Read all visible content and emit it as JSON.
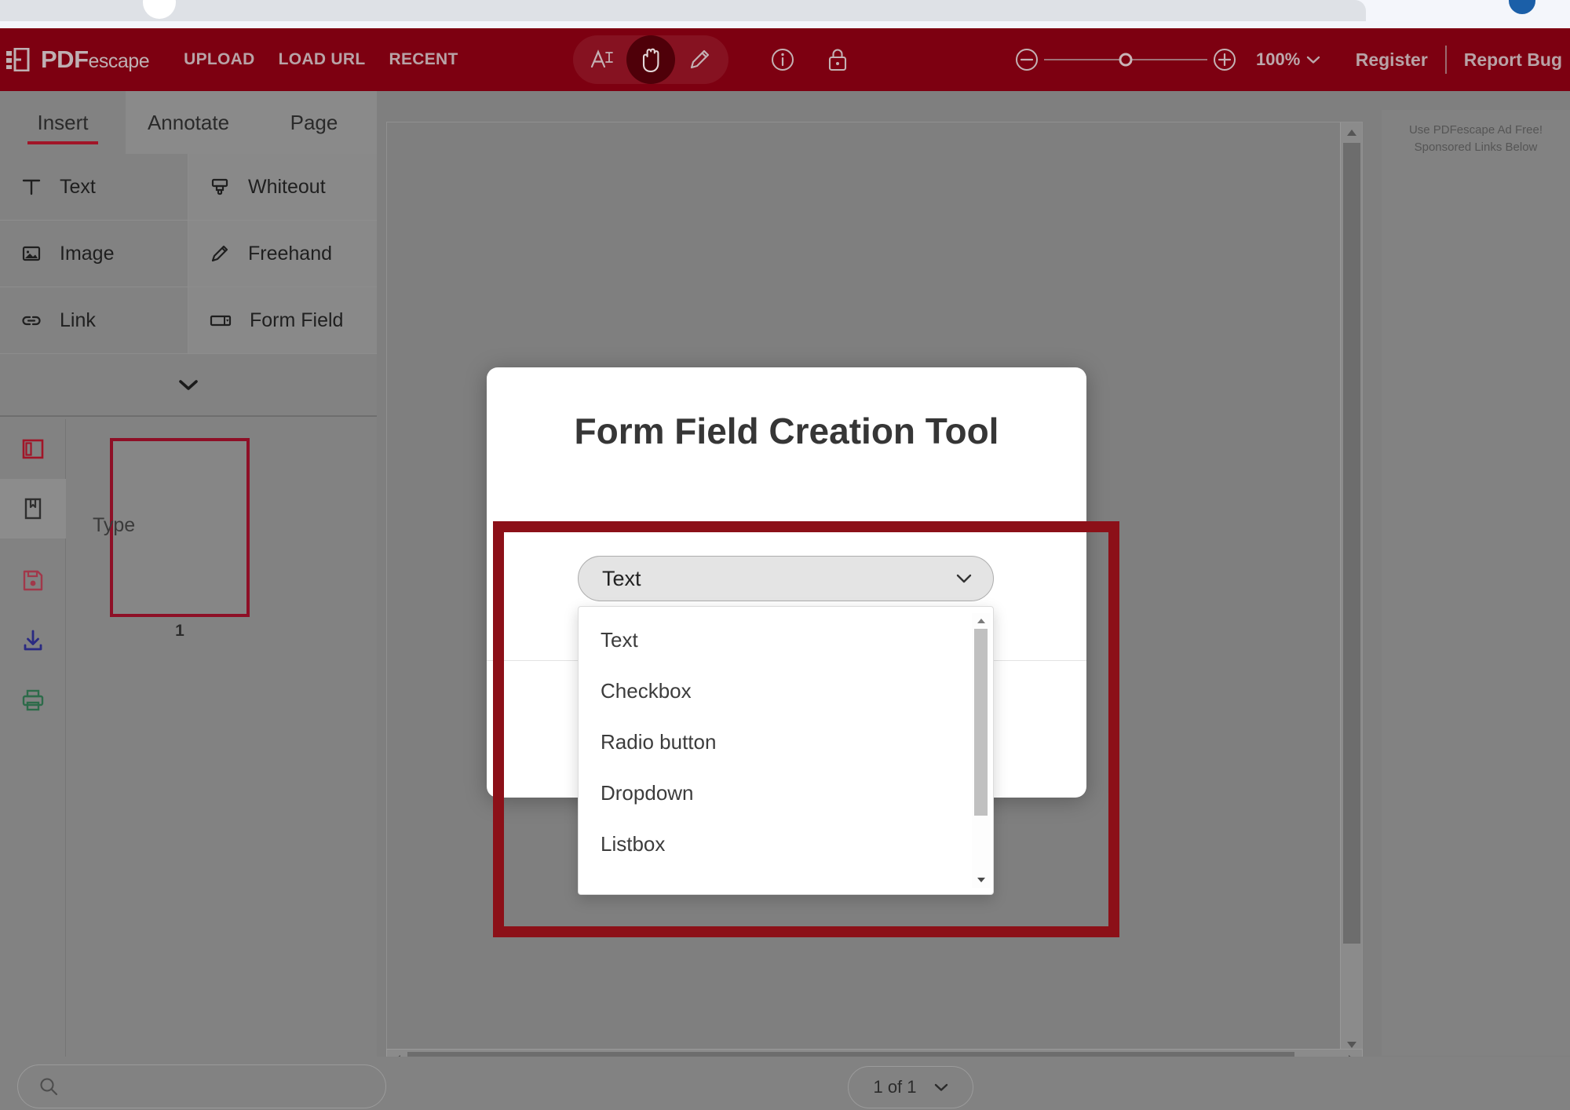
{
  "app": {
    "brand_primary": "PDF",
    "brand_secondary": "escape",
    "header_bg": "#7d0011",
    "accent": "#a11528"
  },
  "header": {
    "nav": [
      {
        "label": "UPLOAD",
        "name": "nav-upload"
      },
      {
        "label": "LOAD URL",
        "name": "nav-load-url"
      },
      {
        "label": "RECENT",
        "name": "nav-recent"
      }
    ],
    "tools": [
      {
        "label": "Select Text",
        "icon": "text-select-icon",
        "active": false
      },
      {
        "label": "Pan",
        "icon": "hand-icon",
        "active": true
      },
      {
        "label": "Draw",
        "icon": "pencil-icon",
        "active": false
      }
    ],
    "extra_tools": [
      {
        "label": "Document Info",
        "icon": "info-icon"
      },
      {
        "label": "Security",
        "icon": "lock-icon"
      }
    ],
    "zoom": {
      "minus_label": "Zoom out",
      "plus_label": "Zoom in",
      "value": "100%"
    },
    "right_links": [
      {
        "label": "Register",
        "name": "register-link"
      },
      {
        "label": "Report Bug",
        "name": "report-bug-link"
      }
    ]
  },
  "sidebar": {
    "tabs": [
      {
        "label": "Insert",
        "active": true
      },
      {
        "label": "Annotate",
        "active": false
      },
      {
        "label": "Page",
        "active": false
      }
    ],
    "tools": [
      {
        "label": "Text",
        "icon": "text-icon"
      },
      {
        "label": "Whiteout",
        "icon": "whiteout-brush-icon"
      },
      {
        "label": "Image",
        "icon": "image-icon"
      },
      {
        "label": "Freehand",
        "icon": "pencil-icon"
      },
      {
        "label": "Link",
        "icon": "link-icon"
      },
      {
        "label": "Form Field",
        "icon": "form-field-icon"
      }
    ],
    "expander_label": "Show more tools",
    "rail_icons": [
      {
        "name": "pages-panel-icon",
        "label": "Pages",
        "color": "#a11528",
        "active": true
      },
      {
        "name": "bookmarks-icon",
        "label": "Bookmarks",
        "color": "#2e2e2e",
        "active": false
      },
      {
        "name": "save-icon",
        "label": "Save",
        "color": "#a1384a",
        "active": false
      },
      {
        "name": "download-icon",
        "label": "Download",
        "color": "#2a2a82",
        "active": false
      },
      {
        "name": "print-icon",
        "label": "Print",
        "color": "#2d6b4a",
        "active": false
      }
    ],
    "page_thumbnail_label": "1"
  },
  "ad_rail": {
    "line1": "Use PDFescape Ad Free!",
    "line2": "Sponsored Links Below"
  },
  "modal": {
    "title": "Form Field Creation Tool",
    "type_label": "Type",
    "selected_type": "Text",
    "options": [
      "Text",
      "Checkbox",
      "Radio button",
      "Dropdown",
      "Listbox"
    ]
  },
  "bottom_bar": {
    "search_placeholder": "",
    "search_value": "",
    "page_indicator": "1 of 1"
  }
}
